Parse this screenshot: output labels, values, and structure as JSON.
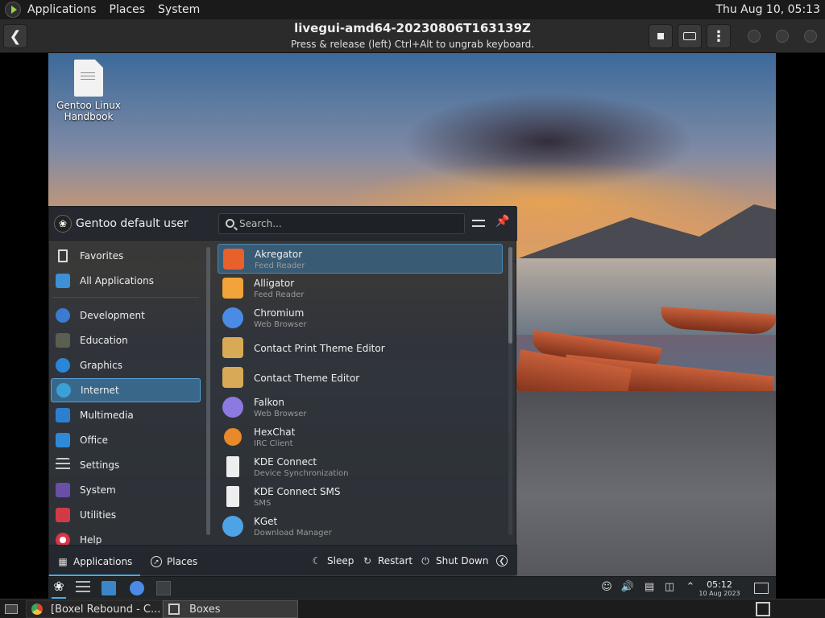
{
  "host_topbar": {
    "menus": [
      "Applications",
      "Places",
      "System"
    ],
    "clock": "Thu Aug 10, 05:13"
  },
  "boxes_header": {
    "title": "livegui-amd64-20230806T163139Z",
    "subtitle": "Press & release (left) Ctrl+Alt to ungrab keyboard."
  },
  "desktop": {
    "icon_label": "Gentoo Linux Handbook"
  },
  "kickoff": {
    "user_name": "Gentoo default user",
    "search_placeholder": "Search...",
    "categories_top": [
      "Favorites",
      "All Applications"
    ],
    "categories": [
      "Development",
      "Education",
      "Graphics",
      "Internet",
      "Multimedia",
      "Office",
      "Settings",
      "System",
      "Utilities",
      "Help"
    ],
    "active_category": "Internet",
    "apps": [
      {
        "name": "Akregator",
        "desc": "Feed Reader",
        "icon": "rss-icon",
        "color": "#e8602c"
      },
      {
        "name": "Alligator",
        "desc": "Feed Reader",
        "icon": "alligator-icon",
        "color": "#f2a33a"
      },
      {
        "name": "Chromium",
        "desc": "Web Browser",
        "icon": "chromium-icon",
        "color": "#4a8be6"
      },
      {
        "name": "Contact Print Theme Editor",
        "desc": "",
        "icon": "theme-editor-icon",
        "color": "#d9aa55"
      },
      {
        "name": "Contact Theme Editor",
        "desc": "",
        "icon": "theme-editor-icon",
        "color": "#d9aa55"
      },
      {
        "name": "Falkon",
        "desc": "Web Browser",
        "icon": "falkon-icon",
        "color": "#8c7ae0"
      },
      {
        "name": "HexChat",
        "desc": "IRC Client",
        "icon": "hexchat-icon",
        "color": "#e8892b"
      },
      {
        "name": "KDE Connect",
        "desc": "Device Synchronization",
        "icon": "phone-icon",
        "color": "#eeeeee"
      },
      {
        "name": "KDE Connect SMS",
        "desc": "SMS",
        "icon": "phone-icon",
        "color": "#eeeeee"
      },
      {
        "name": "KGet",
        "desc": "Download Manager",
        "icon": "download-icon",
        "color": "#4da3e6"
      }
    ],
    "footer": {
      "tab_applications": "Applications",
      "tab_places": "Places",
      "sleep": "Sleep",
      "restart": "Restart",
      "shutdown": "Shut Down"
    }
  },
  "guest_panel": {
    "time": "05:12",
    "date": "10 Aug 2023"
  },
  "host_taskbar": {
    "tasks": [
      "[Boxel Rebound - C...",
      "Boxes"
    ]
  },
  "colors": {
    "accent": "#3daee9",
    "selection": "#3d78a6"
  }
}
